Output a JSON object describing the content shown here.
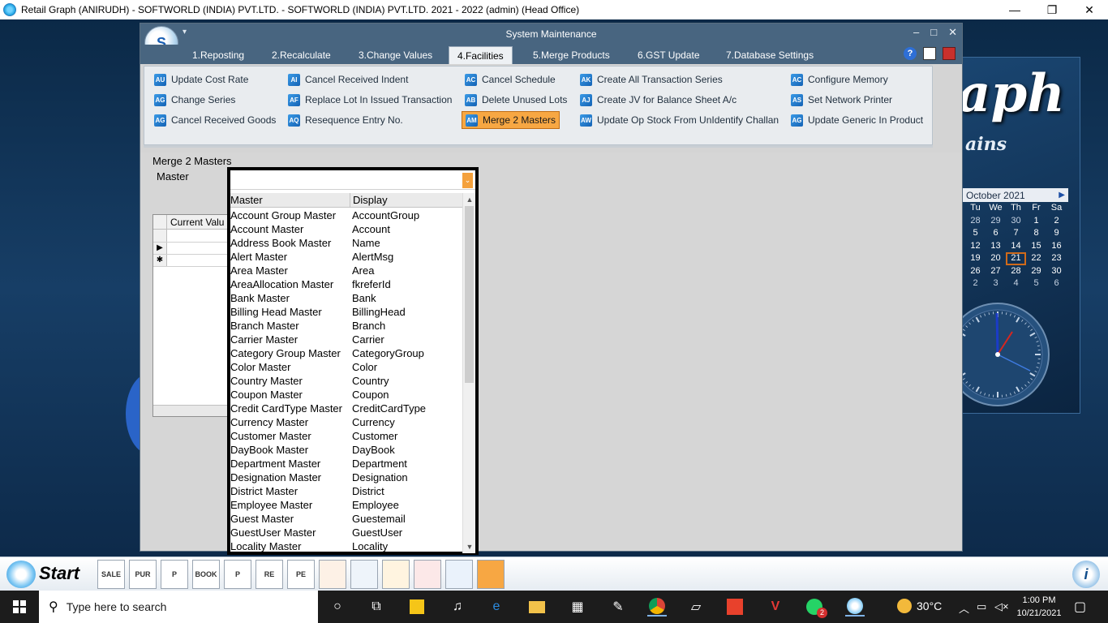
{
  "app_title": "Retail Graph (ANIRUDH) - SOFTWORLD (INDIA) PVT.LTD. - SOFTWORLD (INDIA) PVT.LTD.  2021 - 2022 (admin) (Head Office)",
  "window_controls": {
    "minimize": "—",
    "restore": "❐",
    "close": "✕"
  },
  "brand": {
    "text": "aph",
    "sub": "ains"
  },
  "calendar": {
    "month_label": "October  2021",
    "days": [
      "Tu",
      "We",
      "Th",
      "Fr",
      "Sa"
    ],
    "weeks": [
      [
        "28",
        "29",
        "30",
        "1",
        "2"
      ],
      [
        "5",
        "6",
        "7",
        "8",
        "9"
      ],
      [
        "12",
        "13",
        "14",
        "15",
        "16"
      ],
      [
        "19",
        "20",
        "21",
        "22",
        "23"
      ],
      [
        "26",
        "27",
        "28",
        "29",
        "30"
      ],
      [
        "2",
        "3",
        "4",
        "5",
        "6"
      ]
    ],
    "today": "21"
  },
  "sm_window": {
    "title": "System Maintenance",
    "tabs": [
      {
        "label": "1.Reposting"
      },
      {
        "label": "2.Recalculate"
      },
      {
        "label": "3.Change Values"
      },
      {
        "label": "4.Facilities"
      },
      {
        "label": "5.Merge Products"
      },
      {
        "label": "6.GST Update"
      },
      {
        "label": "7.Database Settings"
      }
    ],
    "active_tab": "4.Facilities",
    "ribbon": [
      {
        "label": "Update Cost Rate",
        "ic": "AU"
      },
      {
        "label": "Change Series",
        "ic": "AG"
      },
      {
        "label": "Cancel Received Goods",
        "ic": "AG"
      },
      {
        "label": "Cancel Received Indent",
        "ic": "AI"
      },
      {
        "label": "Replace Lot In Issued Transaction",
        "ic": "AF"
      },
      {
        "label": "Resequence Entry No.",
        "ic": "AQ"
      },
      {
        "label": "Cancel Schedule",
        "ic": "AC"
      },
      {
        "label": "Delete Unused Lots",
        "ic": "AB"
      },
      {
        "label": "Merge 2 Masters",
        "ic": "AM"
      },
      {
        "label": "Create All Transaction Series",
        "ic": "AK"
      },
      {
        "label": "Create JV for Balance Sheet A/c",
        "ic": "AJ"
      },
      {
        "label": "Update Op Stock From UnIdentify Challan",
        "ic": "AW"
      },
      {
        "label": "Configure Memory",
        "ic": "AC"
      },
      {
        "label": "Set Network Printer",
        "ic": "AS"
      },
      {
        "label": "Update Generic In Product",
        "ic": "AG"
      }
    ],
    "active_ribbon": "Merge 2 Masters",
    "content": {
      "heading": "Merge 2 Masters",
      "master_label": "Master",
      "grid_column": "Current Valu",
      "master_value": ""
    },
    "dropdown": {
      "columns": [
        "Master",
        "Display"
      ],
      "rows": [
        [
          "Account Group Master",
          "AccountGroup"
        ],
        [
          "Account Master",
          "Account"
        ],
        [
          "Address Book Master",
          "Name"
        ],
        [
          "Alert Master",
          "AlertMsg"
        ],
        [
          "Area Master",
          "Area"
        ],
        [
          "AreaAllocation Master",
          "fkreferId"
        ],
        [
          "Bank Master",
          "Bank"
        ],
        [
          "Billing Head Master",
          "BillingHead"
        ],
        [
          "Branch Master",
          "Branch"
        ],
        [
          "Carrier Master",
          "Carrier"
        ],
        [
          "Category Group Master",
          "CategoryGroup"
        ],
        [
          "Color Master",
          "Color"
        ],
        [
          "Country Master",
          "Country"
        ],
        [
          "Coupon Master",
          "Coupon"
        ],
        [
          "Credit CardType Master",
          "CreditCardType"
        ],
        [
          "Currency Master",
          "Currency"
        ],
        [
          "Customer Master",
          "Customer"
        ],
        [
          "DayBook Master",
          "DayBook"
        ],
        [
          "Department Master",
          "Department"
        ],
        [
          "Designation Master",
          "Designation"
        ],
        [
          "District Master",
          "District"
        ],
        [
          "Employee Master",
          "Employee"
        ],
        [
          "Guest Master",
          "Guestemail"
        ],
        [
          "GuestUser Master",
          "GuestUser"
        ],
        [
          "Locality Master",
          "Locality"
        ]
      ]
    }
  },
  "app_toolbar": {
    "start_label": "Start",
    "icons": [
      "SALE",
      "PUR",
      "P",
      "BOOK",
      "P",
      "RE",
      "PE",
      "",
      "",
      "",
      "",
      "",
      "",
      ""
    ]
  },
  "taskbar": {
    "search_placeholder": "Type here to search",
    "weather": "30°C",
    "time": "1:00 PM",
    "date": "10/21/2021",
    "badge": "2"
  }
}
